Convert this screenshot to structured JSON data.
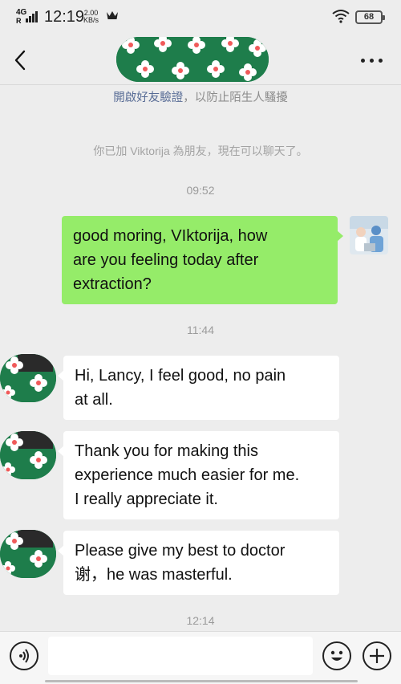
{
  "status_bar": {
    "network_type": "4G",
    "network_r": "R",
    "time": "12:19",
    "speed_value": "2.00",
    "speed_unit": "KB/s",
    "battery": "68"
  },
  "header": {
    "back_icon": "chevron-left-icon",
    "more_icon": "more-dots-icon"
  },
  "system": {
    "verify_link": "開啟好友驗證",
    "verify_rest": "，以防止陌生人騷擾",
    "friend_added": "你已加 Viktorija 為朋友，現在可以聊天了。"
  },
  "messages": {
    "ts1": "09:52",
    "m1": [
      "good moring, VIktorija, how",
      "are you feeling today after",
      "extraction?"
    ],
    "ts2": "11:44",
    "m2": [
      "Hi, Lancy, I feel good, no pain",
      "at all."
    ],
    "m3": [
      "Thank you for making this",
      "experience much easier for me.",
      "I really appreciate it."
    ],
    "m4": [
      "Please give my best to doctor",
      "谢，he was masterful."
    ],
    "ts3": "12:14"
  },
  "input_bar": {
    "voice_icon": "voice-icon",
    "emoji_icon": "emoji-icon",
    "plus_icon": "plus-icon"
  },
  "colors": {
    "my_bubble": "#95ec69",
    "their_bubble": "#ffffff",
    "background": "#ededed",
    "link": "#576b95",
    "blob_green": "#1e7d4b"
  }
}
